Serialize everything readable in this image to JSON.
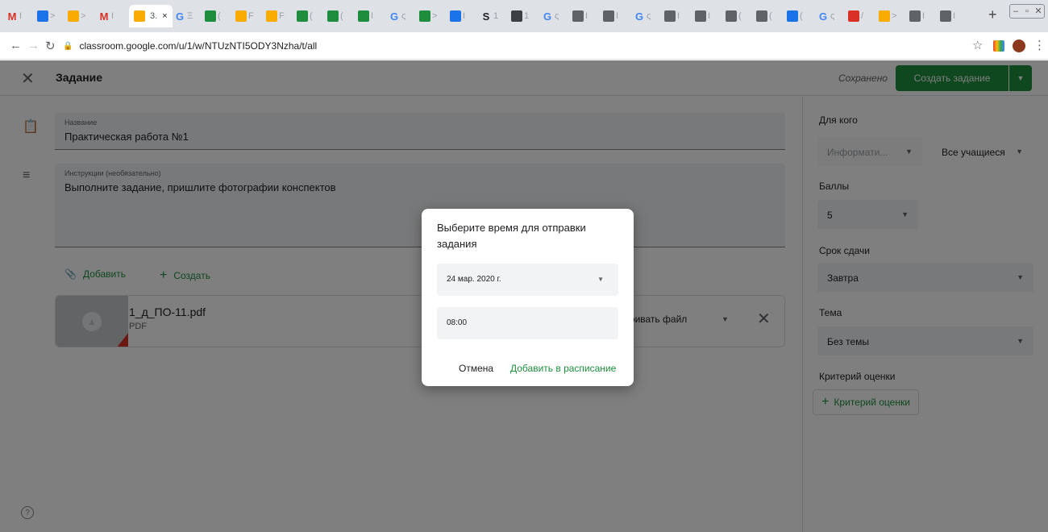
{
  "browser": {
    "tabs": [
      {
        "icon": "gmail-icon",
        "letter": "M",
        "color": "#d93025",
        "text": "I"
      },
      {
        "icon": "classroom-icon",
        "letter": "",
        "color": "#1a73e8",
        "text": ">"
      },
      {
        "icon": "classroom-icon",
        "letter": "",
        "color": "#f9ab00",
        "text": ">"
      },
      {
        "icon": "gmail-icon",
        "letter": "M",
        "color": "#d93025",
        "text": "I"
      },
      {
        "icon": "classroom-icon",
        "letter": "",
        "color": "#f9ab00",
        "text": "3"
      },
      {
        "icon": "google-icon",
        "letter": "G",
        "color": "#4285f4",
        "text": "Ξ"
      },
      {
        "icon": "classroom-icon",
        "letter": "",
        "color": "#1e8e3e",
        "text": "("
      },
      {
        "icon": "classroom-icon",
        "letter": "",
        "color": "#f9ab00",
        "text": "F"
      },
      {
        "icon": "classroom-icon",
        "letter": "",
        "color": "#f9ab00",
        "text": "F"
      },
      {
        "icon": "classroom-icon",
        "letter": "",
        "color": "#1e8e3e",
        "text": "("
      },
      {
        "icon": "classroom-icon",
        "letter": "",
        "color": "#1e8e3e",
        "text": "("
      },
      {
        "icon": "classroom-icon",
        "letter": "",
        "color": "#1e8e3e",
        "text": "I"
      },
      {
        "icon": "google-icon",
        "letter": "G",
        "color": "#4285f4",
        "text": "ς"
      },
      {
        "icon": "classroom-icon",
        "letter": "",
        "color": "#1e8e3e",
        "text": ">"
      },
      {
        "icon": "shield-icon",
        "letter": "",
        "color": "#1a73e8",
        "text": "I"
      },
      {
        "icon": "s-icon",
        "letter": "S",
        "color": "#202124",
        "text": "1"
      },
      {
        "icon": "image-icon",
        "letter": "",
        "color": "#3c4043",
        "text": "1"
      },
      {
        "icon": "google-icon",
        "letter": "G",
        "color": "#4285f4",
        "text": "ς"
      },
      {
        "icon": "drive-icon",
        "letter": "",
        "color": "#5f6368",
        "text": "I"
      },
      {
        "icon": "globe-icon",
        "letter": "",
        "color": "#5f6368",
        "text": "I"
      },
      {
        "icon": "google-icon",
        "letter": "G",
        "color": "#4285f4",
        "text": "ς"
      },
      {
        "icon": "screen-icon",
        "letter": "",
        "color": "#5f6368",
        "text": "I"
      },
      {
        "icon": "screen-icon",
        "letter": "",
        "color": "#5f6368",
        "text": "I"
      },
      {
        "icon": "print-icon",
        "letter": "",
        "color": "#5f6368",
        "text": "("
      },
      {
        "icon": "print-icon",
        "letter": "",
        "color": "#5f6368",
        "text": "("
      },
      {
        "icon": "window-icon",
        "letter": "",
        "color": "#1a73e8",
        "text": "("
      },
      {
        "icon": "google-icon",
        "letter": "G",
        "color": "#4285f4",
        "text": "ς"
      },
      {
        "icon": "youtube-icon",
        "letter": "",
        "color": "#d93025",
        "text": "/"
      },
      {
        "icon": "hand-icon",
        "letter": "",
        "color": "#f9ab00",
        "text": ">"
      },
      {
        "icon": "globe-icon",
        "letter": "",
        "color": "#5f6368",
        "text": "I"
      },
      {
        "icon": "globe-icon",
        "letter": "",
        "color": "#5f6368",
        "text": "I"
      }
    ],
    "active_tab_label": "3.",
    "new_tab": "+",
    "url": "classroom.google.com/u/1/w/NTUzNTI5ODY3Nzha/t/all"
  },
  "header": {
    "title": "Задание",
    "saved": "Сохранено",
    "create_button": "Создать задание"
  },
  "form": {
    "title_label": "Название",
    "title_value": "Практическая работа №1",
    "instructions_label": "Инструкции (необязательно)",
    "instructions_value": "Выполните задание, пришлите фотографии конспектов",
    "add_label": "Добавить",
    "create_label": "Создать"
  },
  "attachment": {
    "name": "1_д_ПО-11.pdf",
    "type": "PDF",
    "access": "атривать файл"
  },
  "sidebar": {
    "for_whom_label": "Для кого",
    "class_value": "Информати...",
    "students_value": "Все учащиеся",
    "points_label": "Баллы",
    "points_value": "5",
    "due_label": "Срок сдачи",
    "due_value": "Завтра",
    "topic_label": "Тема",
    "topic_value": "Без темы",
    "rubric_label": "Критерий оценки",
    "rubric_button": "Критерий оценки"
  },
  "dialog": {
    "title": "Выберите время для отправки задания",
    "date_value": "24 мар. 2020 г.",
    "time_value": "08:00",
    "cancel": "Отмена",
    "add": "Добавить в расписание"
  },
  "colors": {
    "accent": "#1e8e3e",
    "pdf_corner": "#d93025"
  }
}
